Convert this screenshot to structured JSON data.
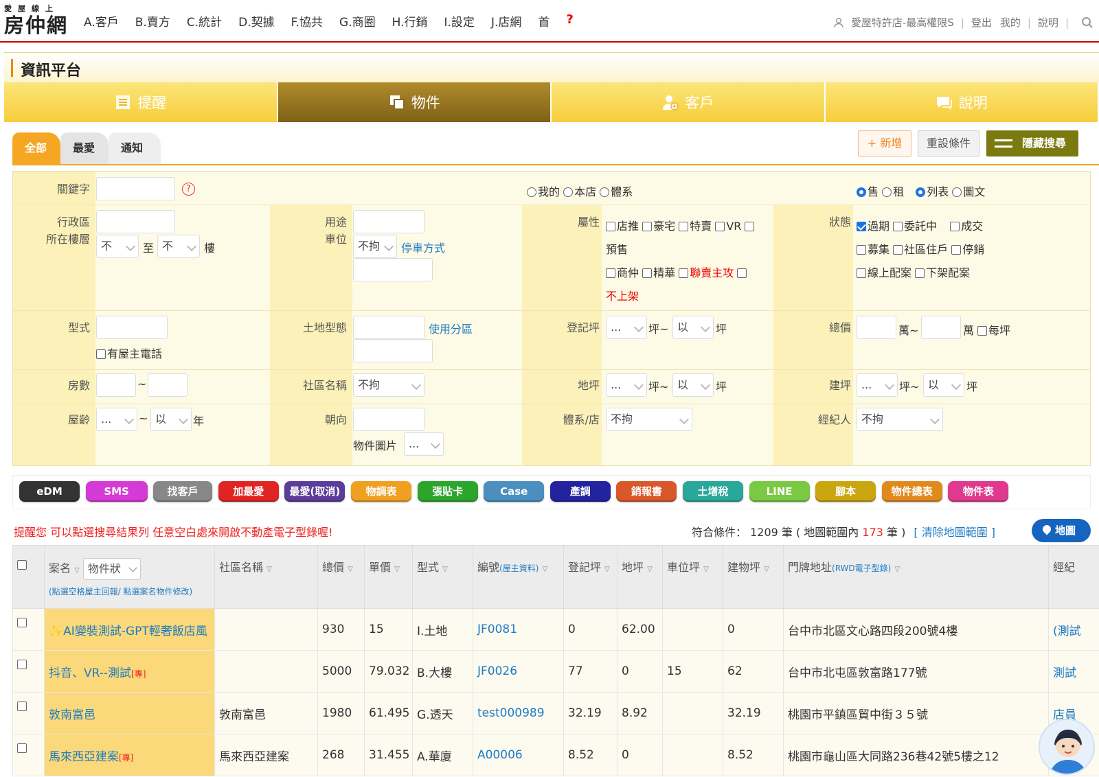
{
  "logo": {
    "small": "愛屋線上",
    "big": "房仲網"
  },
  "menu": [
    "A.客戶",
    "B.賣方",
    "C.統計",
    "D.契據",
    "F.協共",
    "G.商圈",
    "H.行銷",
    "I.設定",
    "J.店網",
    "首",
    "?"
  ],
  "topright": {
    "user": "愛屋特許店-最高權限S",
    "logout": "登出",
    "mine": "我的",
    "help": "說明"
  },
  "page_title": "資訊平台",
  "big_tabs": [
    "提醒",
    "物件",
    "客戶",
    "說明"
  ],
  "sub_tabs": [
    "全部",
    "最愛",
    "通知"
  ],
  "actions": {
    "add": "+ 新增",
    "reset": "重設條件",
    "hide": "隱藏搜尋"
  },
  "form": {
    "keyword": "關鍵字",
    "scope": [
      "我的",
      "本店",
      "體系"
    ],
    "deal": [
      "售",
      "租"
    ],
    "view": [
      "列表",
      "圖文"
    ],
    "district": "行政區",
    "floor": "所在樓層",
    "floor_from": "不",
    "floor_to_label": "至",
    "floor_to": "不",
    "floor_unit": "樓",
    "usage": "用途",
    "parking": "車位",
    "parking_val": "不拘",
    "parking_link": "停車方式",
    "attr": "屬性",
    "attr_items": [
      "店推",
      "豪宅",
      "特賣",
      "VR",
      "預售",
      "商仲",
      "精華",
      "聯賣主攻",
      "不上架"
    ],
    "status": "狀態",
    "status_items": [
      "過期",
      "委託中",
      "成交",
      "募集",
      "社區住戶",
      "停銷",
      "線上配案",
      "下架配案"
    ],
    "type": "型式",
    "owner_phone": "有屋主電話",
    "land_type": "土地型態",
    "zoning_link": "使用分區",
    "reg_ping": "登記坪",
    "total_price": "總價",
    "wan": "萬~",
    "wan2": "萬",
    "per_ping": "每坪",
    "rooms": "房數",
    "community": "社區名稱",
    "community_val": "不拘",
    "land_ping": "地坪",
    "build_ping": "建坪",
    "age": "屋齡",
    "age_unit": "年",
    "facing": "朝向",
    "photo": "物件圖片",
    "system_store": "體系/店",
    "system_val": "不拘",
    "agent": "經紀人",
    "agent_val": "不拘",
    "dots": "...",
    "above": "以",
    "ping_tilde": "坪~",
    "ping": "坪",
    "tilde": "~"
  },
  "color_buttons": [
    {
      "label": "eDM",
      "color": "#333333"
    },
    {
      "label": "SMS",
      "color": "#d63ad6"
    },
    {
      "label": "找客戶",
      "color": "#888888"
    },
    {
      "label": "加最愛",
      "color": "#e02424"
    },
    {
      "label": "最愛(取消)",
      "color": "#5a3c9a"
    },
    {
      "label": "物調表",
      "color": "#f0a020"
    },
    {
      "label": "張貼卡",
      "color": "#2ca52c"
    },
    {
      "label": "Case",
      "color": "#4a8fbf"
    },
    {
      "label": "產調",
      "color": "#2323a0"
    },
    {
      "label": "銷報書",
      "color": "#d9572a"
    },
    {
      "label": "土增稅",
      "color": "#2aa79b"
    },
    {
      "label": "LINE",
      "color": "#7ac943"
    },
    {
      "label": "腳本",
      "color": "#c9a50f"
    },
    {
      "label": "物件總表",
      "color": "#e08a1e"
    },
    {
      "label": "物件表",
      "color": "#e03a8f"
    }
  ],
  "notice": "提醒您 可以點選搜尋結果列 任意空白處來開啟不動產電子型錄喔!",
  "summary": {
    "prefix": "符合條件： 1209 筆 ( 地圖範圍內 ",
    "num": "173",
    "suffix": " 筆 )",
    "clear": "[ 清除地圖範圍 ]"
  },
  "map_button": "地圖",
  "table": {
    "headers": [
      "案名",
      "社區名稱",
      "總價",
      "單價",
      "型式",
      "編號",
      "登記坪",
      "地坪",
      "車位坪",
      "建物坪",
      "門牌地址",
      "經紀"
    ],
    "name_select": "物件狀",
    "name_sub": "(點選空格屋主回報/ 點選案名物件修改)",
    "code_sub": "(屋主資料)",
    "addr_sub": "(RWD電子型錄)",
    "rows": [
      {
        "name": "AI變裝測試-GPT輕奢飯店風",
        "tag": "",
        "community": "",
        "total": "930",
        "unit": "15",
        "type": "I.土地",
        "code": "JF0081",
        "reg": "0",
        "land": "62.00",
        "park": "",
        "build": "0",
        "addr": "台中市北區文心路四段200號4樓",
        "agent": "(測試"
      },
      {
        "name": "抖音、VR--測試",
        "tag": "[專]",
        "community": "",
        "total": "5000",
        "unit": "79.032",
        "type": "B.大樓",
        "code": "JF0026",
        "reg": "77",
        "land": "0",
        "park": "15",
        "build": "62",
        "addr": "台中市北屯區敦富路177號",
        "agent": "測試"
      },
      {
        "name": "敦南富邑",
        "tag": "",
        "community": "敦南富邑",
        "total": "1980",
        "unit": "61.495",
        "type": "G.透天",
        "code": "test000989",
        "reg": "32.19",
        "land": "8.92",
        "park": "",
        "build": "32.19",
        "addr": "桃園市平鎮區貿中街３５號",
        "agent": "店員"
      },
      {
        "name": "馬來西亞建案",
        "tag": "[專]",
        "community": "馬來西亞建案",
        "total": "268",
        "unit": "31.455",
        "type": "A.華廈",
        "code": "A00006",
        "reg": "8.52",
        "land": "0",
        "park": "",
        "build": "8.52",
        "addr": "桃園市龜山區大同路236巷42號5樓之12",
        "agent": ""
      }
    ]
  }
}
